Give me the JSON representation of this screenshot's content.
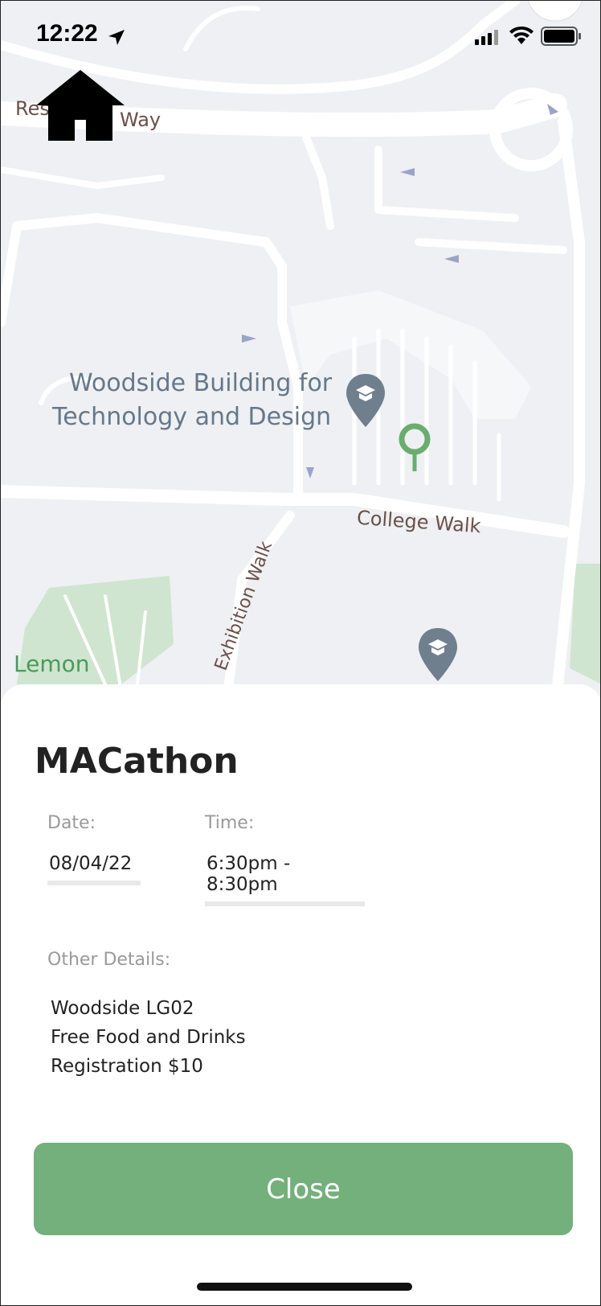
{
  "status_bar": {
    "time": "12:22",
    "icons": [
      "location-arrow-icon",
      "cellular-signal-icon",
      "wifi-icon",
      "battery-icon"
    ]
  },
  "home_button": {
    "icon": "home-icon"
  },
  "map": {
    "labels": {
      "road_top": "Way",
      "road_top_partial": "Res",
      "building_line1": "Woodside Building for",
      "building_line2": "Technology and Design",
      "college_walk": "College Walk",
      "exhibition_walk": "Exhibition Walk",
      "lemon": "Lemon"
    },
    "pin_color": "#6aad6f",
    "poi_color": "#6f7f8e"
  },
  "event": {
    "title": "MACathon",
    "date_label": "Date:",
    "date_value": "08/04/22",
    "time_label": "Time:",
    "time_value": "6:30pm - 8:30pm",
    "details_label": "Other Details:",
    "details": [
      "Woodside LG02",
      "Free Food and Drinks",
      "Registration $10"
    ]
  },
  "close_button": {
    "label": "Close",
    "color": "#74b07b"
  }
}
